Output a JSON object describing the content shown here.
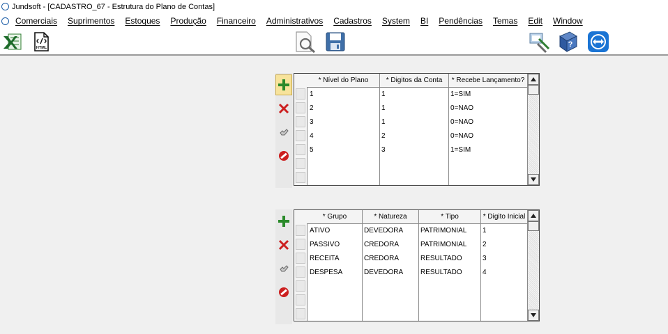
{
  "window": {
    "title": "Jundsoft - [CADASTRO_67 - Estrutura do Plano de Contas]"
  },
  "menu": {
    "items": [
      "Comerciais",
      "Suprimentos",
      "Estoques",
      "Produção",
      "Financeiro",
      "Administrativos",
      "Cadastros",
      "System",
      "BI",
      "Pendências",
      "Temas",
      "Edit",
      "Window"
    ]
  },
  "toolbar": {
    "html_label": "HTML"
  },
  "grid1": {
    "headers": [
      "* Nível do Plano",
      "* Digitos da Conta",
      "* Recebe Lançamento?"
    ],
    "rows": [
      [
        "1",
        "1",
        "1=SIM"
      ],
      [
        "2",
        "1",
        "0=NAO"
      ],
      [
        "3",
        "1",
        "0=NAO"
      ],
      [
        "4",
        "2",
        "0=NAO"
      ],
      [
        "5",
        "3",
        "1=SIM"
      ]
    ]
  },
  "grid2": {
    "headers": [
      "* Grupo",
      "* Natureza",
      "* Tipo",
      "* Digito Inicial"
    ],
    "rows": [
      [
        "ATIVO",
        "DEVEDORA",
        "PATRIMONIAL",
        "1"
      ],
      [
        "PASSIVO",
        "CREDORA",
        "PATRIMONIAL",
        "2"
      ],
      [
        "RECEITA",
        "CREDORA",
        "RESULTADO",
        "3"
      ],
      [
        "DESPESA",
        "DEVEDORA",
        "RESULTADO",
        "4"
      ]
    ]
  },
  "colors": {
    "add": "#2a8a2a",
    "delete": "#cc1f1f",
    "cancel": "#cc1f1f",
    "active_button": "#f7e39b"
  }
}
